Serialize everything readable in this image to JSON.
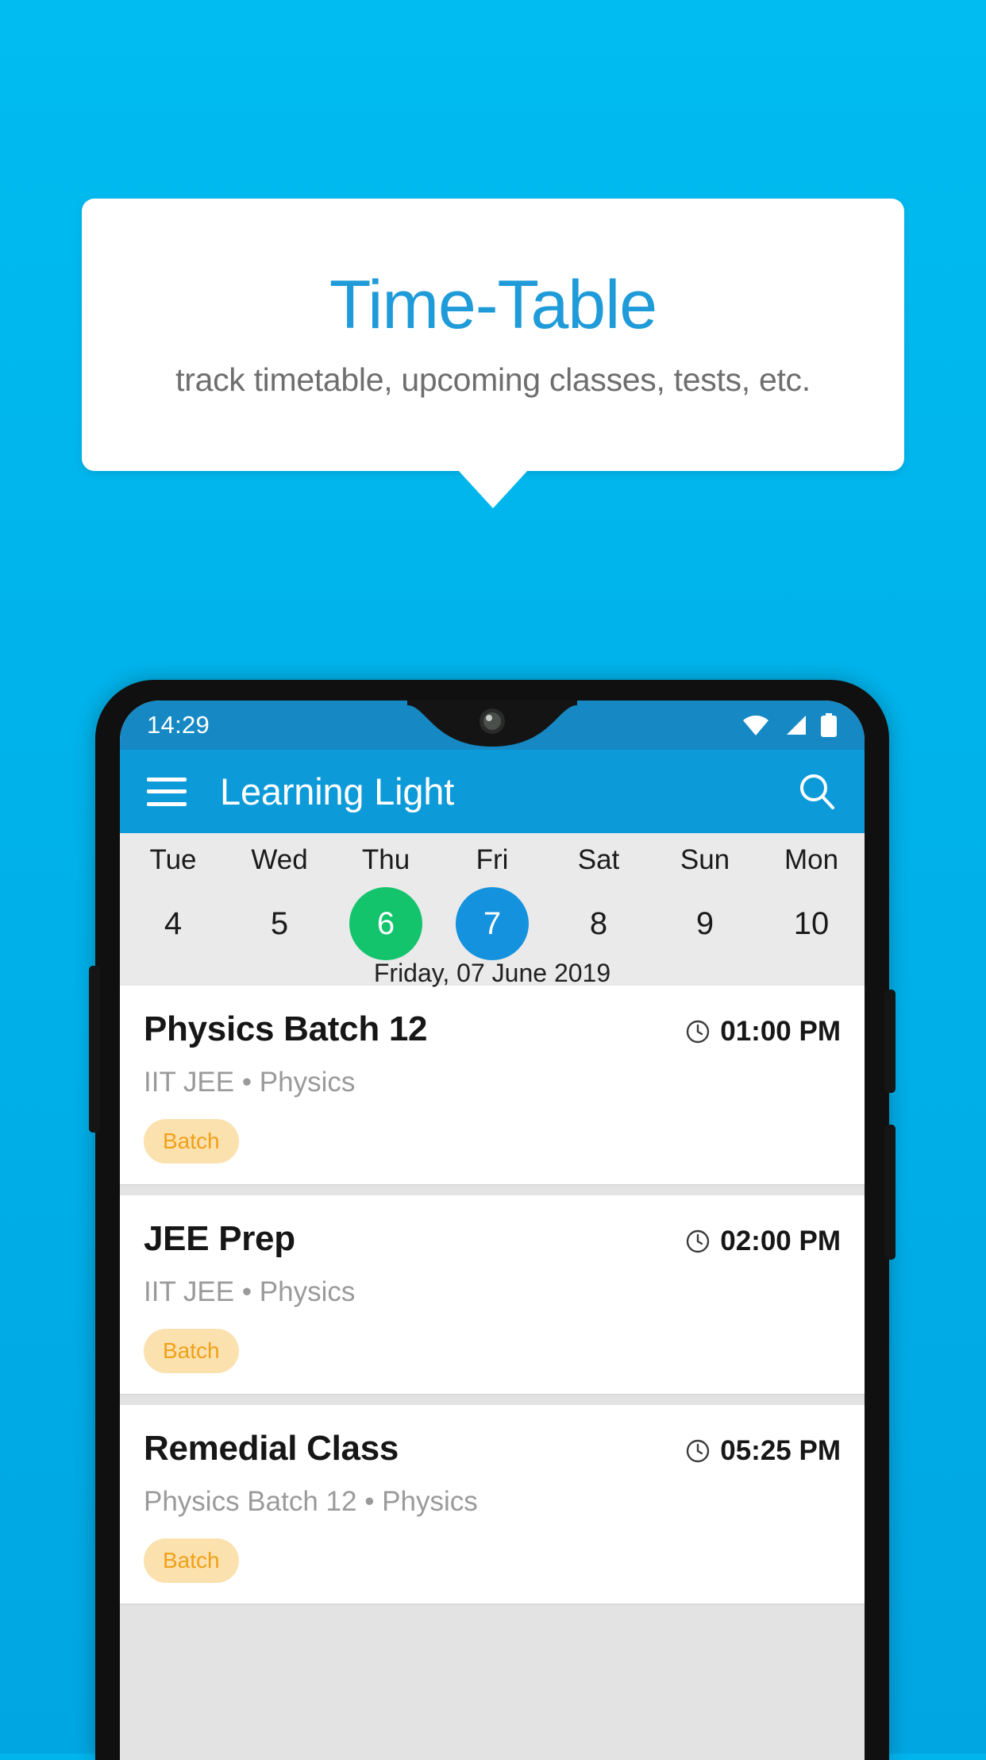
{
  "promo": {
    "title": "Time-Table",
    "subtitle": "track timetable, upcoming classes, tests, etc."
  },
  "colors": {
    "background": "#00B4EC",
    "promo_title": "#1E9BD8",
    "appbar": "#0D9AD8",
    "statusbar": "#1689C4",
    "today_circle": "#14C46D",
    "selected_circle": "#1592DE",
    "chip_bg": "#FBE1AE",
    "chip_text": "#F0A11A"
  },
  "phone": {
    "statusbar": {
      "time": "14:29",
      "icons": [
        "wifi-icon",
        "signal-icon",
        "battery-icon"
      ]
    },
    "appbar": {
      "menu_icon": "hamburger-menu-icon",
      "title": "Learning Light",
      "search_icon": "search-icon"
    },
    "datestrip": {
      "days": [
        {
          "name": "Tue",
          "num": "4",
          "state": "normal"
        },
        {
          "name": "Wed",
          "num": "5",
          "state": "normal"
        },
        {
          "name": "Thu",
          "num": "6",
          "state": "today"
        },
        {
          "name": "Fri",
          "num": "7",
          "state": "selected"
        },
        {
          "name": "Sat",
          "num": "8",
          "state": "normal"
        },
        {
          "name": "Sun",
          "num": "9",
          "state": "normal"
        },
        {
          "name": "Mon",
          "num": "10",
          "state": "normal"
        }
      ],
      "full_date": "Friday, 07 June 2019"
    },
    "classes": [
      {
        "title": "Physics Batch 12",
        "time": "01:00 PM",
        "subtitle": "IIT JEE • Physics",
        "chip": "Batch"
      },
      {
        "title": "JEE Prep",
        "time": "02:00 PM",
        "subtitle": "IIT JEE • Physics",
        "chip": "Batch"
      },
      {
        "title": "Remedial Class",
        "time": "05:25 PM",
        "subtitle": "Physics Batch 12 • Physics",
        "chip": "Batch"
      }
    ]
  }
}
